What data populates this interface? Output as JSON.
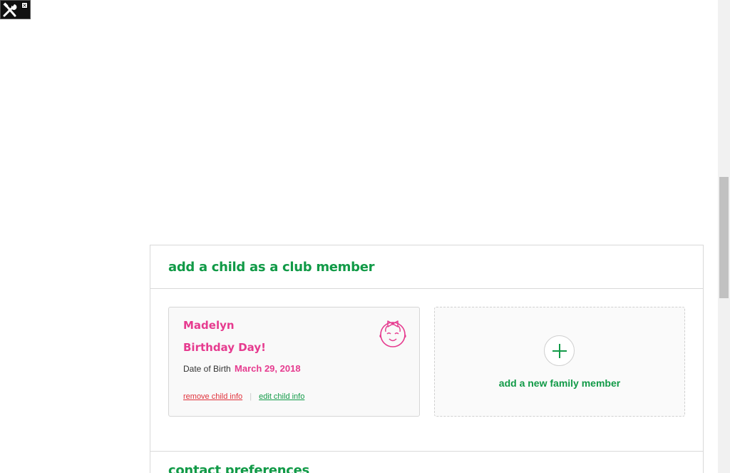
{
  "tool_widget": {
    "icon": "tools-icon",
    "close_symbol": "×"
  },
  "section": {
    "title": "add a child as a club member"
  },
  "child": {
    "name": "Madelyn",
    "birthday_text": "Birthday Day!",
    "dob_label": "Date of Birth",
    "dob_value": "March 29, 2018",
    "remove_label": "remove child info",
    "separator": "|",
    "edit_label": "edit child info",
    "avatar_icon": "baby-girl-icon"
  },
  "add_member": {
    "label": "add a new family member",
    "icon": "plus-icon"
  },
  "next_section": {
    "title": "contact preferences"
  },
  "colors": {
    "green": "#119a47",
    "pink": "#e63b8f",
    "red": "#e0313b"
  }
}
